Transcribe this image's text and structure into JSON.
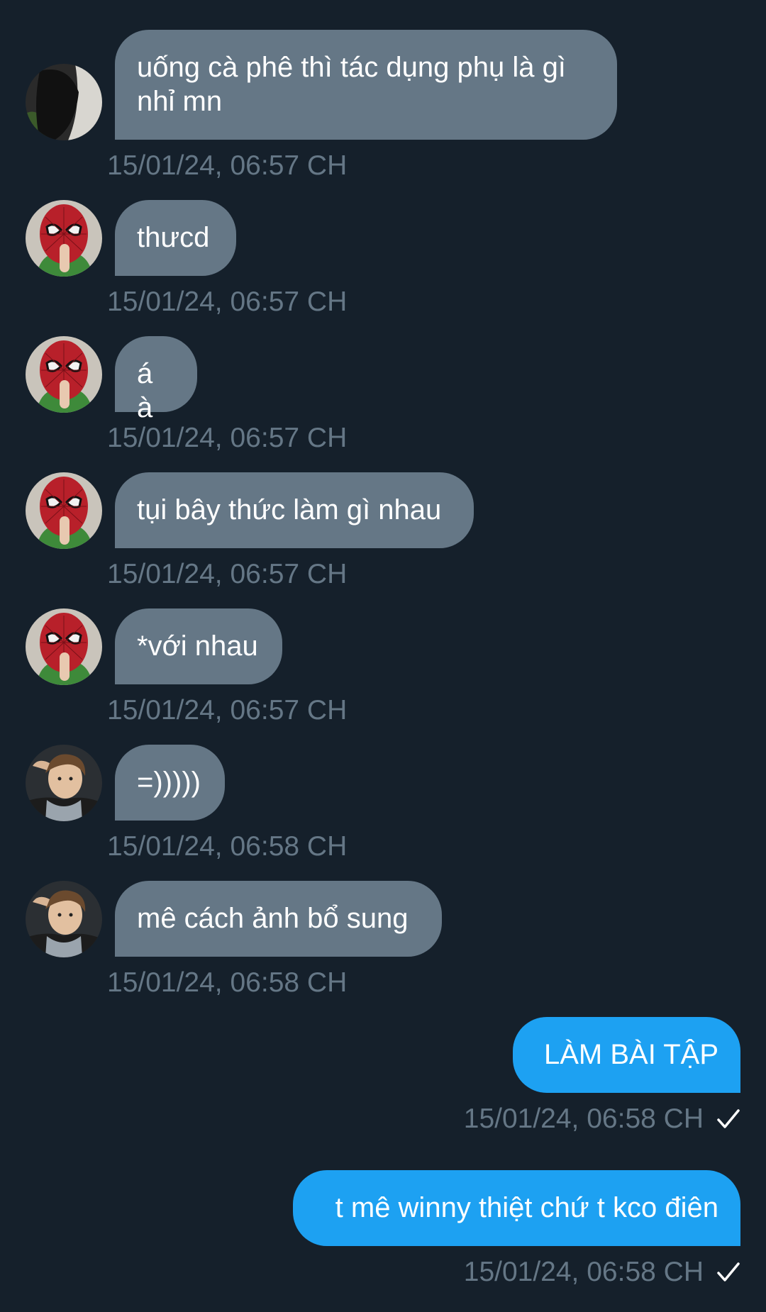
{
  "colors": {
    "background": "#15202b",
    "incoming_bubble": "#657786",
    "outgoing_bubble": "#1da1f2",
    "timestamp": "#657786"
  },
  "messages": [
    {
      "direction": "incoming",
      "avatar": "dark-avatar",
      "text": "uống cà phê thì tác dụng phụ là gì nhỉ mn",
      "time": "15/01/24, 06:57 CH"
    },
    {
      "direction": "incoming",
      "avatar": "spiderman-avatar",
      "text": "thưcd",
      "time": "15/01/24, 06:57 CH"
    },
    {
      "direction": "incoming",
      "avatar": "spiderman-avatar",
      "text": "á à",
      "time": "15/01/24, 06:57 CH"
    },
    {
      "direction": "incoming",
      "avatar": "spiderman-avatar",
      "text": "tụi bây thức làm gì nhau",
      "time": "15/01/24, 06:57 CH"
    },
    {
      "direction": "incoming",
      "avatar": "spiderman-avatar",
      "text": "*với nhau",
      "time": "15/01/24, 06:57 CH"
    },
    {
      "direction": "incoming",
      "avatar": "boy-avatar",
      "text": "=)))))",
      "time": "15/01/24, 06:58 CH"
    },
    {
      "direction": "incoming",
      "avatar": "boy-avatar",
      "text": "mê cách ảnh bổ sung",
      "time": "15/01/24, 06:58 CH"
    },
    {
      "direction": "outgoing",
      "text": "LÀM BÀI TẬP",
      "time": "15/01/24, 06:58 CH",
      "status_icon": "check-icon"
    },
    {
      "direction": "outgoing",
      "text": "t mê winny thiệt chứ t kco điên",
      "time": "15/01/24, 06:58 CH",
      "status_icon": "check-icon"
    }
  ]
}
